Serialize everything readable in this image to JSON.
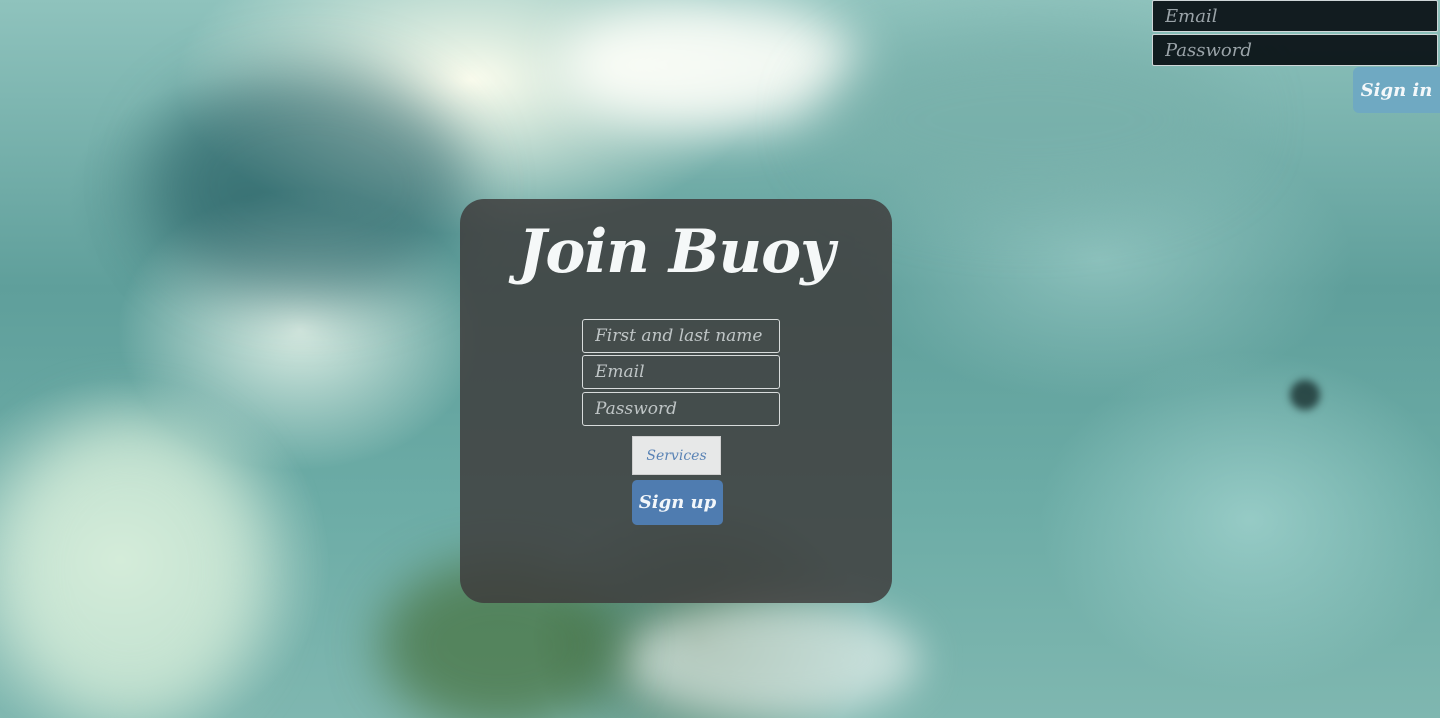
{
  "signin": {
    "email_placeholder": "Email",
    "password_placeholder": "Password",
    "button_label": "Sign in"
  },
  "signup": {
    "title": "Join Buoy",
    "name_placeholder": "First and last name",
    "email_placeholder": "Email",
    "password_placeholder": "Password",
    "services_selected": "Services",
    "button_label": "Sign up"
  },
  "colors": {
    "signin_button": "#6fa9c2",
    "signup_button": "#4f7cb0",
    "card_background": "#3e3c3c"
  }
}
